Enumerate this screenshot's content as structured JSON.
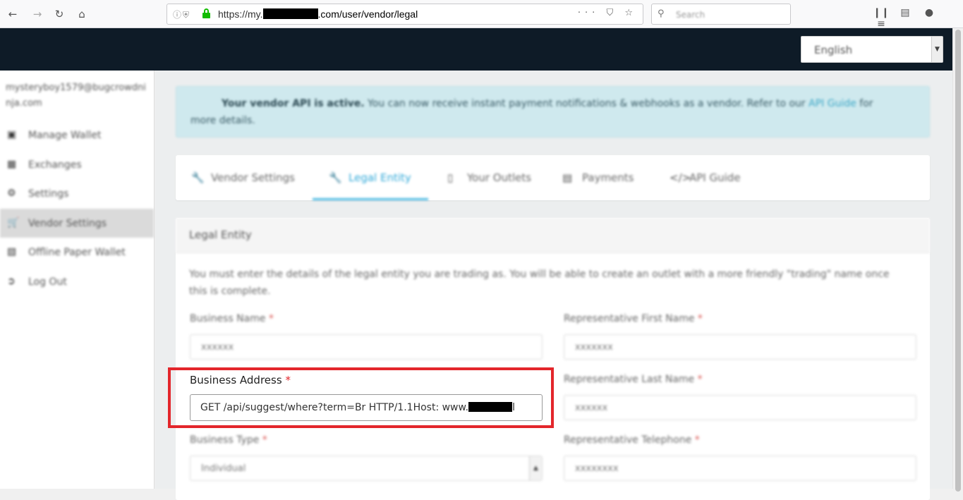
{
  "browser": {
    "url_prefix": "https://my.",
    "url_suffix": ".com/user/vendor/legal",
    "search_placeholder": "Search",
    "url_actions": "··· ⛉ ☆"
  },
  "header": {
    "language": "English"
  },
  "sidebar": {
    "email": "mysteryboy1579@bugcrowdninja.com",
    "items": [
      {
        "label": "Manage Wallet",
        "icon": "wallet-icon"
      },
      {
        "label": "Exchanges",
        "icon": "exchange-icon"
      },
      {
        "label": "Settings",
        "icon": "gear-icon"
      },
      {
        "label": "Vendor Settings",
        "icon": "cart-icon",
        "active": true
      },
      {
        "label": "Offline Paper Wallet",
        "icon": "qr-icon"
      },
      {
        "label": "Log Out",
        "icon": "logout-icon"
      }
    ]
  },
  "alert": {
    "bold": "Your vendor API is active.",
    "text": " You can now receive instant payment notifications & webhooks as a vendor. Refer to our ",
    "link": "API Guide",
    "text_after": " for",
    "line2": "more details."
  },
  "tabs": [
    {
      "label": "Vendor Settings",
      "icon": "wrench-icon"
    },
    {
      "label": "Legal Entity",
      "icon": "wrench-icon",
      "active": true
    },
    {
      "label": "Your Outlets",
      "icon": "phone-icon"
    },
    {
      "label": "Payments",
      "icon": "card-icon"
    },
    {
      "label": "API Guide",
      "icon": "code-icon"
    }
  ],
  "card": {
    "title": "Legal Entity",
    "intro": "You must enter the details of the legal entity you are trading as. You will be able to create an outlet with a more friendly \"trading\" name once this is complete.",
    "required_marker": "*",
    "fields": {
      "business_name": {
        "label": "Business Name",
        "value": "xxxxxx"
      },
      "rep_first_name": {
        "label": "Representative First Name",
        "value": "xxxxxxx"
      },
      "business_address": {
        "label": "Business Address",
        "value": "GET /api/suggest/where?term=Br HTTP/1.1Host: www.",
        "value_tail": "l"
      },
      "rep_last_name": {
        "label": "Representative Last Name",
        "value": "xxxxxx"
      },
      "business_type": {
        "label": "Business Type",
        "value": "Individual"
      },
      "rep_telephone": {
        "label": "Representative Telephone",
        "value": "xxxxxxxx"
      }
    }
  }
}
